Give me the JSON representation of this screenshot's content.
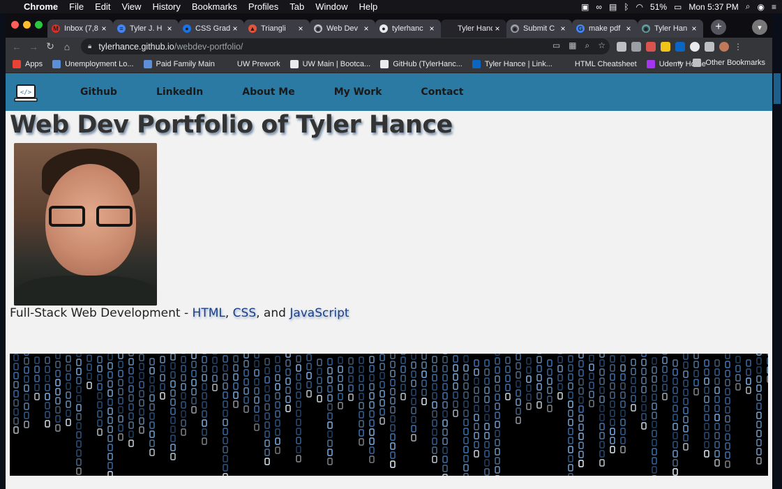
{
  "menubar": {
    "app": "Chrome",
    "items": [
      "File",
      "Edit",
      "View",
      "History",
      "Bookmarks",
      "Profiles",
      "Tab",
      "Window",
      "Help"
    ],
    "battery": "51%",
    "clock": "Mon 5:37 PM"
  },
  "tabs": [
    {
      "title": "Inbox (7,8",
      "fav_color": "#d93025",
      "fav_glyph": "M"
    },
    {
      "title": "Tyler J. H",
      "fav_color": "#4285f4",
      "fav_glyph": "≡"
    },
    {
      "title": "CSS Grad",
      "fav_color": "#1a73e8",
      "fav_glyph": "●"
    },
    {
      "title": "Triangli",
      "fav_color": "#e2543b",
      "fav_glyph": "▲"
    },
    {
      "title": "Web Dev",
      "fav_color": "#bdc1c6",
      "fav_glyph": "◉"
    },
    {
      "title": "tylerhanc",
      "fav_color": "#e8eaed",
      "fav_glyph": "●"
    },
    {
      "title": "Tyler Hanc",
      "fav_color": "#24242a",
      "fav_glyph": " "
    },
    {
      "title": "Submit C",
      "fav_color": "#9aa0a6",
      "fav_glyph": "◉"
    },
    {
      "title": "make pdf",
      "fav_color": "#4285f4",
      "fav_glyph": "G"
    },
    {
      "title": "Tyler Han",
      "fav_color": "#5f9ea0",
      "fav_glyph": "◉"
    }
  ],
  "address_bar": {
    "host": "tylerhance.github.io",
    "path": "/webdev-portfolio/"
  },
  "bookmarks": [
    {
      "label": "Apps",
      "color": "#ea4335"
    },
    {
      "label": "Unemployment Lo...",
      "color": "#5b8fd8"
    },
    {
      "label": "Paid Family Main",
      "color": "#5b8fd8"
    },
    {
      "label": "UW Prework",
      "color": "#35363a"
    },
    {
      "label": "UW Main | Bootca...",
      "color": "#e8eaed"
    },
    {
      "label": "GitHub (TylerHanc...",
      "color": "#e8eaed"
    },
    {
      "label": "Tyler Hance | Link...",
      "color": "#0a66c2"
    },
    {
      "label": "HTML Cheatsheet",
      "color": "#35363a"
    },
    {
      "label": "Udemy Home",
      "color": "#a435f0"
    }
  ],
  "bookmarks_more": "»",
  "other_bookmarks": "Other Bookmarks",
  "site": {
    "nav": [
      "Github",
      "LinkedIn",
      "About Me",
      "My Work",
      "Contact"
    ],
    "title": "Web Dev Portfolio of Tyler Hance",
    "tagline_prefix": "Full-Stack Web Development - ",
    "tagline_kw1": "HTML",
    "tagline_sep1": ", ",
    "tagline_kw2": "CSS",
    "tagline_sep2": ", and ",
    "tagline_kw3": "JavaScript"
  },
  "colors": {
    "nav_bg": "#2a7aa3",
    "page_bg": "#f2f2f2",
    "keyword": "#1c3f8a"
  }
}
